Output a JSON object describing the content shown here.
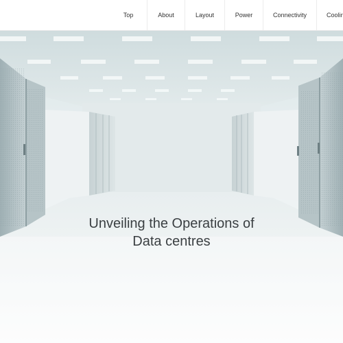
{
  "nav": {
    "items": [
      {
        "label": "Top"
      },
      {
        "label": "About"
      },
      {
        "label": "Layout"
      },
      {
        "label": "Power"
      },
      {
        "label": "Connectivity"
      },
      {
        "label": "Cooling"
      }
    ]
  },
  "hero": {
    "title_line1": "Unveiling the Operations of",
    "title_line2": "Data centres"
  }
}
